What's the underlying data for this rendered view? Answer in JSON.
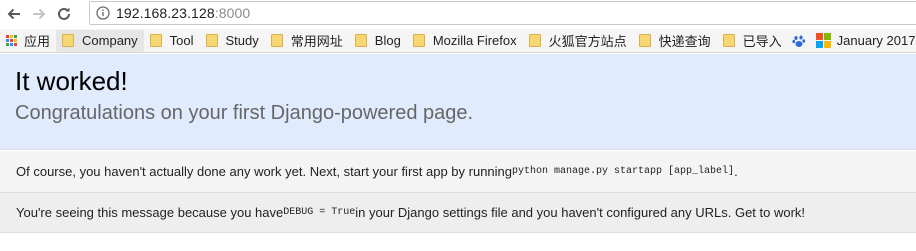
{
  "browser": {
    "url_host": "192.168.23.128",
    "url_port": ":8000",
    "colors": {
      "folder": "#f7d774",
      "page_header_bg": "#e1ebfe"
    }
  },
  "bookmarks": {
    "apps_label": "应用",
    "items": [
      {
        "label": "Company",
        "icon": "folder-icon"
      },
      {
        "label": "Tool",
        "icon": "folder-icon"
      },
      {
        "label": "Study",
        "icon": "folder-icon"
      },
      {
        "label": "常用网址",
        "icon": "folder-icon"
      },
      {
        "label": "Blog",
        "icon": "folder-icon"
      },
      {
        "label": "Mozilla Firefox",
        "icon": "folder-icon"
      },
      {
        "label": "火狐官方站点",
        "icon": "folder-icon"
      },
      {
        "label": "快递查询",
        "icon": "folder-icon"
      },
      {
        "label": "已导入",
        "icon": "folder-icon"
      },
      {
        "label": "January 2017",
        "icon": "microsoft-logo-icon"
      }
    ]
  },
  "page": {
    "title": "It worked!",
    "subtitle": "Congratulations on your first Django-powered page.",
    "instructions_text": "Of course, you haven't actually done any work yet. Next, start your first app by running ",
    "instructions_code": "python manage.py startapp [app_label]",
    "instructions_end": ".",
    "explanation_pre": "You're seeing this message because you have ",
    "explanation_code": "DEBUG = True",
    "explanation_post": " in your Django settings file and you haven't configured any URLs. Get to work!"
  }
}
